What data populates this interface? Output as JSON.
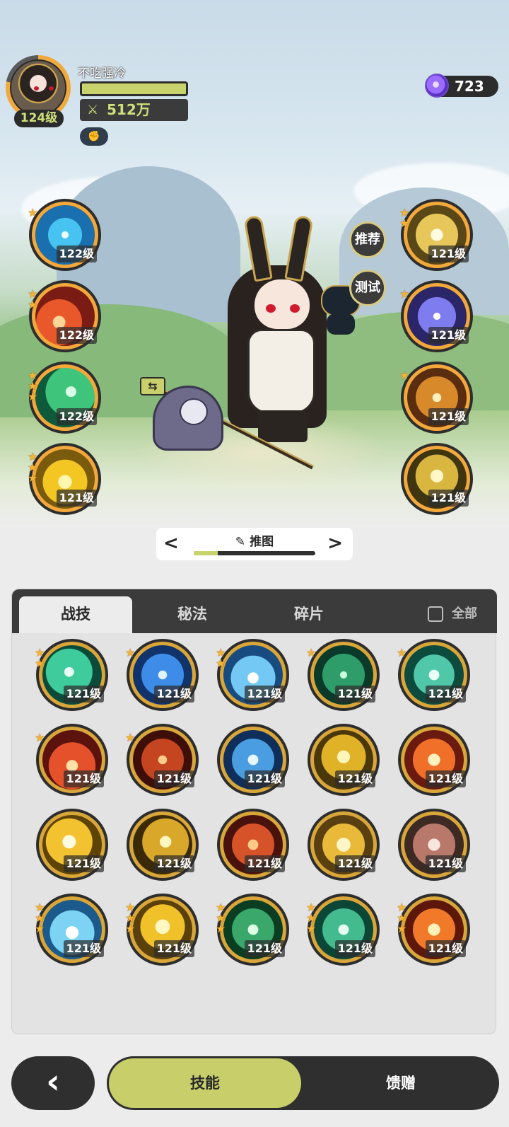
{
  "player": {
    "name": "不吃强冷",
    "level": "124级",
    "power": "512万",
    "currency": "723"
  },
  "scene_buttons": {
    "recommend": "推荐",
    "test": "测试"
  },
  "equipped_left": [
    {
      "level": "122级",
      "stars": 1,
      "art": "water-vortex"
    },
    {
      "level": "122级",
      "stars": 2,
      "art": "fire-meteor"
    },
    {
      "level": "122级",
      "stars": 3,
      "art": "wind-slash"
    },
    {
      "level": "121级",
      "stars": 3,
      "art": "lightning-orb"
    }
  ],
  "equipped_right": [
    {
      "level": "121级",
      "stars": 2,
      "art": "light-burst"
    },
    {
      "level": "121级",
      "stars": 1,
      "art": "arcane-sphere"
    },
    {
      "level": "121级",
      "stars": 1,
      "art": "golden-sword"
    },
    {
      "level": "121级",
      "stars": 0,
      "art": "summon-spirit"
    }
  ],
  "stage": {
    "label": "推图",
    "progress": 0.2,
    "prev": "<",
    "next": ">"
  },
  "tabs": {
    "items": [
      "战技",
      "秘法",
      "碎片"
    ],
    "active": "战技",
    "all_label": "全部"
  },
  "skills": [
    {
      "level": "121级",
      "stars": 2,
      "art": "wind-blades"
    },
    {
      "level": "121级",
      "stars": 1,
      "art": "water-flame"
    },
    {
      "level": "121级",
      "stars": 2,
      "art": "ice-shards"
    },
    {
      "level": "121级",
      "stars": 1,
      "art": "thorn-vine"
    },
    {
      "level": "121级",
      "stars": 1,
      "art": "wind-swirl"
    },
    {
      "level": "121级",
      "stars": 1,
      "art": "fire-burst"
    },
    {
      "level": "121级",
      "stars": 1,
      "art": "fire-swirl"
    },
    {
      "level": "121级",
      "stars": 0,
      "art": "ice-crystal"
    },
    {
      "level": "121级",
      "stars": 0,
      "art": "gold-prism"
    },
    {
      "level": "121级",
      "stars": 0,
      "art": "fire-orb"
    },
    {
      "level": "121级",
      "stars": 0,
      "art": "light-flash"
    },
    {
      "level": "121级",
      "stars": 0,
      "art": "lightning-bolt"
    },
    {
      "level": "121级",
      "stars": 0,
      "art": "lava-flame"
    },
    {
      "level": "121级",
      "stars": 0,
      "art": "star-sword"
    },
    {
      "level": "121级",
      "stars": 0,
      "art": "card-trick"
    },
    {
      "level": "121级",
      "stars": 3,
      "art": "ice-spikes"
    },
    {
      "level": "121级",
      "stars": 3,
      "art": "sun-totem"
    },
    {
      "level": "121级",
      "stars": 3,
      "art": "heal-cross"
    },
    {
      "level": "121级",
      "stars": 3,
      "art": "wind-sphere"
    },
    {
      "level": "121级",
      "stars": 3,
      "art": "fire-dragon"
    }
  ],
  "bottom": {
    "back": "‹",
    "skills_tab": "技能",
    "gift_tab": "馈赠"
  },
  "colors": {
    "accent": "#c8cf6a",
    "panel_dark": "#3b3b3b",
    "gold_ring": "#d9a63a",
    "star": "#f4b335"
  }
}
